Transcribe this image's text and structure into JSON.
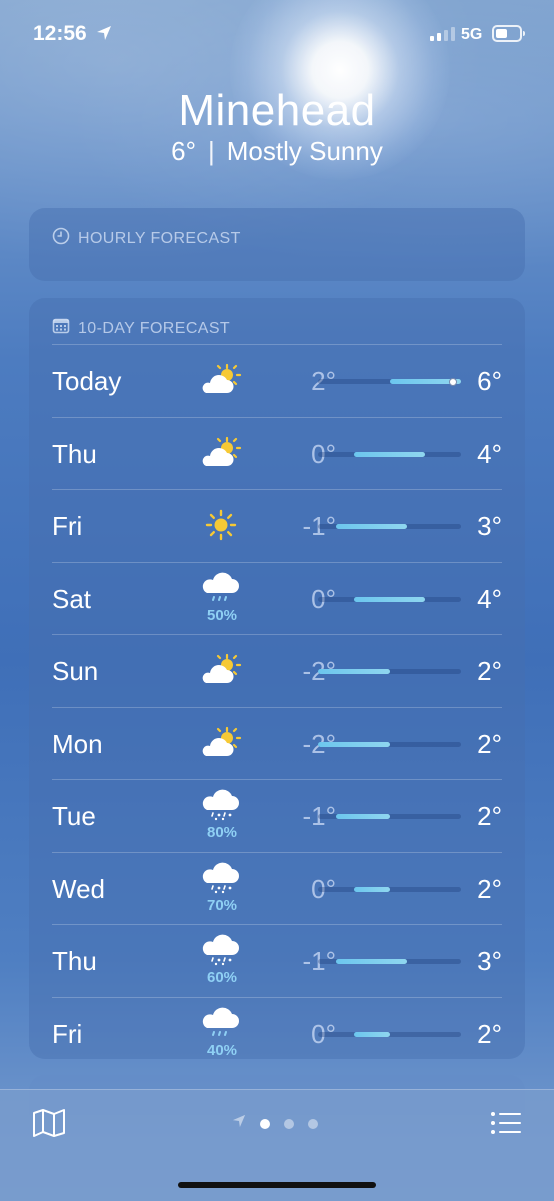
{
  "status": {
    "time": "12:56",
    "network": "5G"
  },
  "location": {
    "city": "Minehead",
    "temperature": "6°",
    "condition": "Mostly Sunny"
  },
  "hourly": {
    "title": "HOURLY FORECAST"
  },
  "forecast": {
    "title": "10-DAY FORECAST",
    "range_min": -2,
    "range_max": 6,
    "days": [
      {
        "day": "Today",
        "icon": "partly-sunny-icon",
        "precip": "",
        "low": "2°",
        "high": "6°",
        "low_val": 2,
        "high_val": 6,
        "current_val": 6
      },
      {
        "day": "Thu",
        "icon": "partly-sunny-icon",
        "precip": "",
        "low": "0°",
        "high": "4°",
        "low_val": 0,
        "high_val": 4
      },
      {
        "day": "Fri",
        "icon": "sun-icon",
        "precip": "",
        "low": "-1°",
        "high": "3°",
        "low_val": -1,
        "high_val": 3
      },
      {
        "day": "Sat",
        "icon": "rain-cloud-icon",
        "precip": "50%",
        "low": "0°",
        "high": "4°",
        "low_val": 0,
        "high_val": 4
      },
      {
        "day": "Sun",
        "icon": "partly-sunny-icon",
        "precip": "",
        "low": "-2°",
        "high": "2°",
        "low_val": -2,
        "high_val": 2
      },
      {
        "day": "Mon",
        "icon": "partly-sunny-icon",
        "precip": "",
        "low": "-2°",
        "high": "2°",
        "low_val": -2,
        "high_val": 2
      },
      {
        "day": "Tue",
        "icon": "sleet-cloud-icon",
        "precip": "80%",
        "low": "-1°",
        "high": "2°",
        "low_val": -1,
        "high_val": 2
      },
      {
        "day": "Wed",
        "icon": "sleet-cloud-icon",
        "precip": "70%",
        "low": "0°",
        "high": "2°",
        "low_val": 0,
        "high_val": 2
      },
      {
        "day": "Thu",
        "icon": "sleet-cloud-icon",
        "precip": "60%",
        "low": "-1°",
        "high": "3°",
        "low_val": -1,
        "high_val": 3
      },
      {
        "day": "Fri",
        "icon": "rain-cloud-icon",
        "precip": "40%",
        "low": "0°",
        "high": "2°",
        "low_val": 0,
        "high_val": 2
      }
    ]
  },
  "pager": {
    "count": 3,
    "active": 0
  },
  "colors": {
    "bar_cold": "#6cc6ee",
    "bar_mild": "#8fd6ef",
    "sun": "#f6c935",
    "cloud": "#ffffff"
  }
}
